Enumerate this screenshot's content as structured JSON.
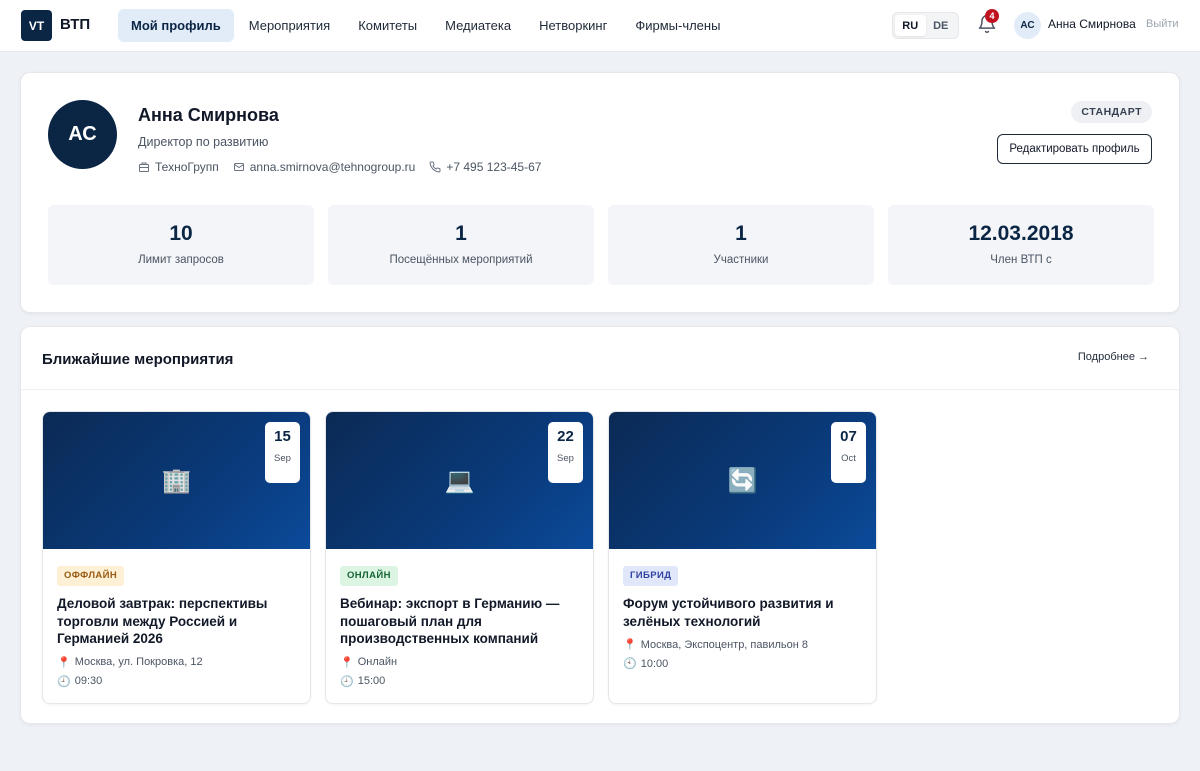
{
  "header": {
    "logo_text": "VT",
    "brand": "ВТП",
    "nav": [
      {
        "label": "Мой профиль",
        "active": true
      },
      {
        "label": "Мероприятия",
        "active": false
      },
      {
        "label": "Комитеты",
        "active": false
      },
      {
        "label": "Медиатека",
        "active": false
      },
      {
        "label": "Нетворкинг",
        "active": false
      },
      {
        "label": "Фирмы-члены",
        "active": false
      }
    ],
    "languages": [
      {
        "label": "RU",
        "active": true
      },
      {
        "label": "DE",
        "active": false
      }
    ],
    "notifications_count": "4",
    "user_initials": "АС",
    "user_name": "Анна Смирнова",
    "logout_label": "Выйти"
  },
  "profile": {
    "initials": "АС",
    "name": "Анна Смирнова",
    "role": "Директор по развитию",
    "company": "ТехноГрупп",
    "email": "anna.smirnova@tehnogroup.ru",
    "phone": "+7 495 123-45-67",
    "tier": "СТАНДАРТ",
    "edit_label": "Редактировать профиль",
    "stats": [
      {
        "value": "10",
        "label": "Лимит запросов"
      },
      {
        "value": "1",
        "label": "Посещённых мероприятий"
      },
      {
        "value": "1",
        "label": "Участники"
      },
      {
        "value": "12.03.2018",
        "label": "Член ВТП с"
      }
    ]
  },
  "events": {
    "title": "Ближайшие мероприятия",
    "more_label": "Подробнее →",
    "items": [
      {
        "day": "15",
        "month": "Sep",
        "image_icon": "🏢",
        "format": "ОФФЛАЙН",
        "format_kind": "offline",
        "title": "Деловой завтрак: перспективы торговли между Россией и Германией 2026",
        "location": "Москва, ул. Покровка, 12",
        "time": "09:30"
      },
      {
        "day": "22",
        "month": "Sep",
        "image_icon": "💻",
        "format": "ОНЛАЙН",
        "format_kind": "online",
        "title": "Вебинар: экспорт в Германию — пошаговый план для производственных компаний",
        "location": "Онлайн",
        "time": "15:00"
      },
      {
        "day": "07",
        "month": "Oct",
        "image_icon": "🔄",
        "format": "ГИБРИД",
        "format_kind": "hybrid",
        "title": "Форум устойчивого развития и зелёных технологий",
        "location": "Москва, Экспоцентр, павильон 8",
        "time": "10:00"
      }
    ]
  },
  "icons": {
    "company": "building-icon",
    "email": "mail-icon",
    "phone": "phone-icon",
    "location": "pin-icon",
    "time": "clock-icon",
    "notifications": "bell-icon"
  },
  "colors": {
    "brand_navy": "#0b2545",
    "active_nav_bg": "#e2ecf8",
    "badge_red": "#c1121f",
    "offline_badge": "#fdf0d5",
    "online_badge": "#dcf5e3",
    "hybrid_badge": "#e0e7fb"
  }
}
